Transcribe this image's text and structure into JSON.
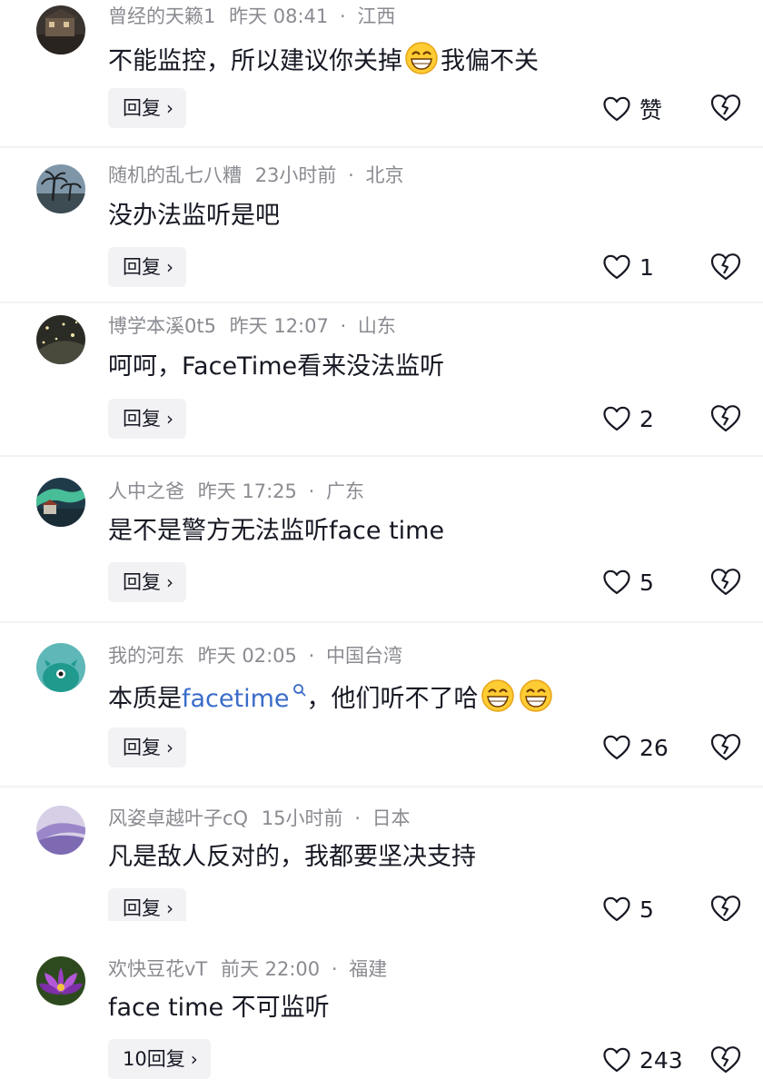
{
  "comments": [
    {
      "user": "曾经的天籁1",
      "time": "昨天 08:41",
      "location": "江西",
      "text_before": "不能监控，所以建议你关掉",
      "emoji_count": 1,
      "text_after": "我偏不关",
      "reply_label": "回复",
      "like_label": "赞",
      "avatar_icon": "night-house-avatar",
      "liked": false
    },
    {
      "user": "随机的乱七八糟",
      "time": "23小时前",
      "location": "北京",
      "text_before": "没办法监听是吧",
      "emoji_count": 0,
      "text_after": "",
      "reply_label": "回复",
      "like_label": "1",
      "avatar_icon": "palm-beach-avatar"
    },
    {
      "user": "博学本溪0t5",
      "time": "昨天 12:07",
      "location": "山东",
      "text_before": "呵呵，FaceTime看来没法监听",
      "emoji_count": 0,
      "text_after": "",
      "reply_label": "回复",
      "like_label": "2",
      "avatar_icon": "firefly-avatar"
    },
    {
      "user": "人中之爸",
      "time": "昨天 17:25",
      "location": "广东",
      "text_before": "是不是警方无法监听face time",
      "emoji_count": 0,
      "text_after": "",
      "reply_label": "回复",
      "like_label": "5",
      "avatar_icon": "aurora-avatar"
    },
    {
      "user": "我的河东",
      "time": "昨天 02:05",
      "location": "中国台湾",
      "text_before": "本质是",
      "link": "facetime",
      "text_after": "，他们听不了哈",
      "emoji_count": 2,
      "reply_label": "回复",
      "like_label": "26",
      "avatar_icon": "green-monster-avatar"
    },
    {
      "user": "风姿卓越叶子cQ",
      "time": "15小时前",
      "location": "日本",
      "text_before": "凡是敌人反对的，我都要坚决支持",
      "emoji_count": 0,
      "text_after": "",
      "reply_label": "回复",
      "like_label": "5",
      "avatar_icon": "purple-wave-avatar"
    },
    {
      "user": "欢快豆花vT",
      "time": "前天 22:00",
      "location": "福建",
      "text_before": "face time 不可监听",
      "emoji_count": 0,
      "text_after": "",
      "reply_label": "10回复",
      "like_label": "243",
      "avatar_icon": "lotus-flower-avatar"
    }
  ],
  "meta_separator": "·",
  "colors": {
    "link": "#3a6cc9",
    "meta": "#8a8b91",
    "reply_bg": "#f2f2f4",
    "text": "#161823"
  }
}
